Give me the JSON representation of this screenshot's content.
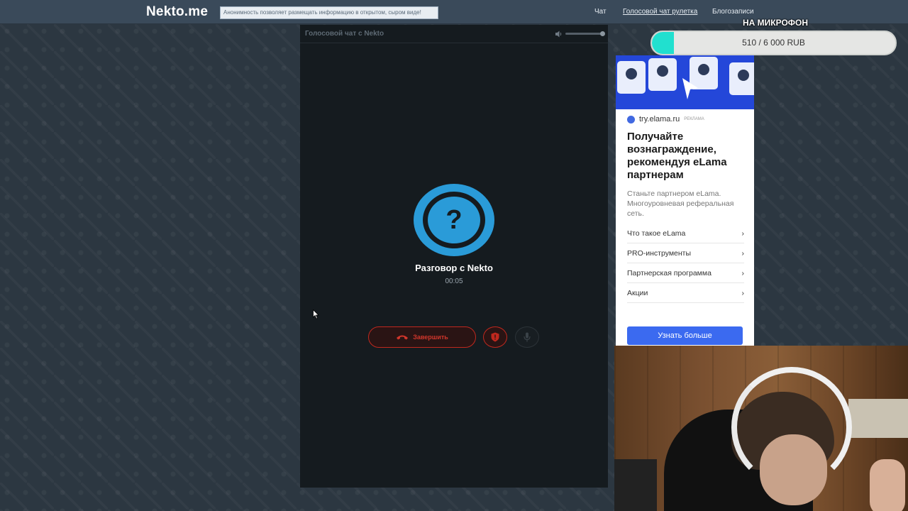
{
  "header": {
    "logo": "Nekto.me",
    "tagline": "Анонимность позволяет размещать информацию в открытом, сыром виде!",
    "nav": [
      {
        "label": "Чат",
        "active": false
      },
      {
        "label": "Голосовой чат рулетка",
        "active": true
      },
      {
        "label": "Блогозаписи",
        "active": false
      }
    ]
  },
  "chat": {
    "panel_title": "Голосовой чат с Nekto",
    "avatar_symbol": "?",
    "call_title": "Разговор с Nekto",
    "timer": "00:05",
    "end_label": "Завершить",
    "volume_level": 0.9
  },
  "donation": {
    "label": "НА МИКРОФОН",
    "progress_text": "510 / 6 000 RUB",
    "progress_fraction": 0.085,
    "fill_color": "#21e0cf"
  },
  "ad": {
    "domain": "try.elama.ru",
    "ad_label": "РЕКЛАМА",
    "headline": "Получайте вознаграждение, рекомендуя eLama партнерам",
    "description": "Станьте партнером eLama. Многоуровневая реферальная сеть.",
    "links": [
      "Что такое eLama",
      "PRO-инструменты",
      "Партнерская программа",
      "Акции"
    ],
    "cta": "Узнать больше",
    "accent": "#3b6af0"
  },
  "colors": {
    "header_bg": "#3a4a5a",
    "panel_bg": "#151b1f",
    "avatar": "#2a9bd8",
    "danger": "#c0281e"
  }
}
